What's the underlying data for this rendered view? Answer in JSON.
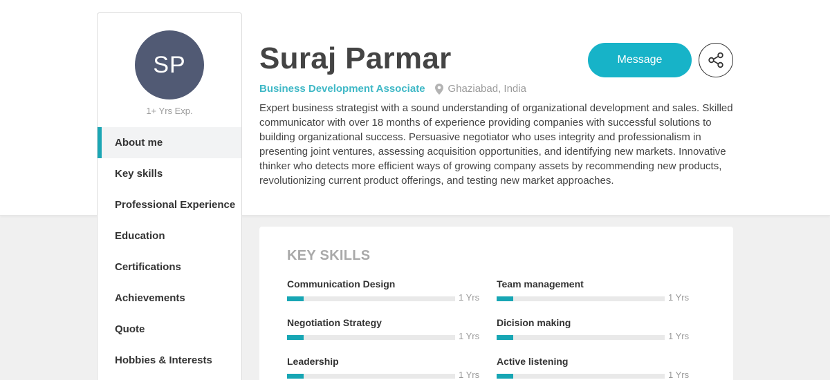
{
  "profile": {
    "initials": "SP",
    "experience": "1+ Yrs Exp.",
    "name": "Suraj Parmar",
    "role": "Business Development Associate",
    "location": "Ghaziabad, India",
    "bio": "Expert business strategist with a sound understanding of organizational development and sales. Skilled communicator with over 18 months of experience providing companies with successful solutions to building organizational success. Persuasive negotiator who uses integrity and professionalism in presenting joint ventures, assessing acquisition opportunities, and identifying new markets. Innovative thinker who detects more efficient ways of growing company assets by recommending new products, revolutionizing current product offerings, and testing new market approaches."
  },
  "actions": {
    "message_label": "Message",
    "share_icon": "share-icon"
  },
  "nav": {
    "active": "About me",
    "items": [
      {
        "label": "About me"
      },
      {
        "label": "Key skills"
      },
      {
        "label": "Professional Experience"
      },
      {
        "label": "Education"
      },
      {
        "label": "Certifications"
      },
      {
        "label": "Achievements"
      },
      {
        "label": "Quote"
      },
      {
        "label": "Hobbies & Interests"
      }
    ]
  },
  "skills": {
    "title": "KEY SKILLS",
    "items": [
      {
        "name": "Communication Design",
        "years": "1 Yrs",
        "level": 0.1
      },
      {
        "name": "Team management",
        "years": "1 Yrs",
        "level": 0.1
      },
      {
        "name": "Negotiation Strategy",
        "years": "1 Yrs",
        "level": 0.1
      },
      {
        "name": "Dicision making",
        "years": "1 Yrs",
        "level": 0.1
      },
      {
        "name": "Leadership",
        "years": "1 Yrs",
        "level": 0.1
      },
      {
        "name": "Active listening",
        "years": "1 Yrs",
        "level": 0.1
      }
    ]
  },
  "colors": {
    "accent": "#17b3c8",
    "bar": "#17a6b4",
    "avatar_bg": "#515a74",
    "role_text": "#3fb8c6"
  }
}
